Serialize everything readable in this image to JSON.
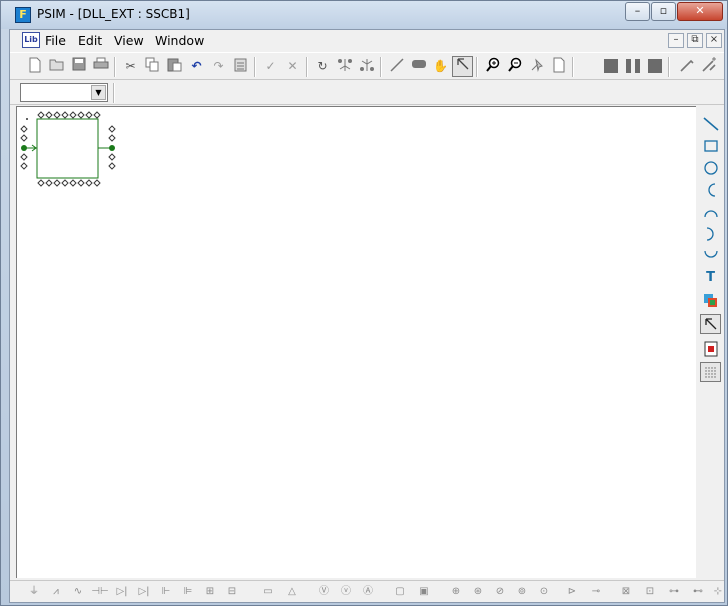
{
  "window": {
    "title": "PSIM - [DLL_EXT : SSCB1]",
    "app_icon_glyph": "F",
    "minimize_glyph": "–",
    "maximize_glyph": "▫",
    "close_glyph": "✕"
  },
  "menu": {
    "doc_icon_text": "Lib",
    "items": [
      "File",
      "Edit",
      "View",
      "Window"
    ],
    "mdi_minimize": "–",
    "mdi_restore": "⧉",
    "mdi_close": "×"
  },
  "toolbar": {
    "icons": [
      "new-icon",
      "open-icon",
      "save-icon",
      "print-icon",
      "cut-icon",
      "copy-icon",
      "paste-icon",
      "undo-icon",
      "redo-icon",
      "paste-special-icon",
      "check-icon",
      "delete-icon",
      "rotate-icon",
      "flip-lr-icon",
      "flip-tb-icon",
      "wire-icon",
      "label-icon",
      "pan-icon",
      "select-icon",
      "zoom-in-icon",
      "zoom-out-icon",
      "fit-icon",
      "page-icon",
      "run-icon",
      "pause-icon",
      "stop-icon",
      "probe-icon",
      "probe-diff-icon"
    ]
  },
  "selector": {
    "value": "",
    "arrow": "▼"
  },
  "right_toolbar": {
    "tools": [
      "line-tool",
      "rectangle-tool",
      "circle-tool",
      "arc-left-tool",
      "arc-top-tool",
      "arc-right-tool",
      "arc-bottom-tool",
      "text-tool",
      "image-tool",
      "select-tool",
      "color-tool",
      "grid-tool"
    ],
    "text_tool_label": "T"
  },
  "bottom_toolbar": {
    "elements": [
      "ground-icon",
      "resistor-icon",
      "inductor-icon",
      "capacitor-icon",
      "diode-icon",
      "thyristor-icon",
      "switch-icon",
      "igbt-icon",
      "mosfet-icon",
      "transformer-icon",
      "sum-icon",
      "source-icon",
      "voltage-probe-icon",
      "current-probe-icon",
      "scope-icon",
      "meter-icon",
      "dc-source-icon",
      "ac-source-icon",
      "current-source-icon",
      "step-source-icon",
      "sawtooth-icon",
      "comparator-icon",
      "gain-icon",
      "pi-icon",
      "limiter-icon",
      "integrator-icon"
    ]
  }
}
